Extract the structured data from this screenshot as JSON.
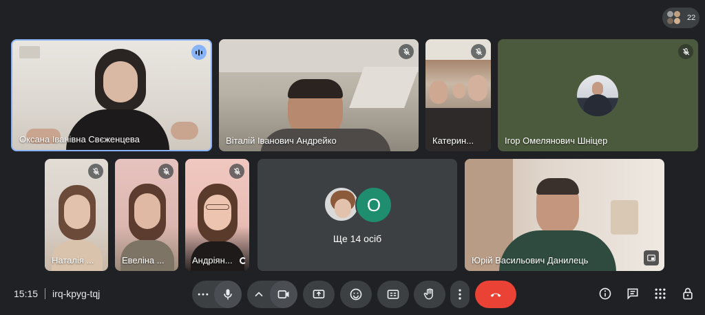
{
  "participants_badge": {
    "count": "22",
    "avatar_colors": [
      "#9e9e9e",
      "#c0a080",
      "#7a6a5a",
      "#d0b090"
    ]
  },
  "tiles": {
    "t1": {
      "name": "Оксана Іванівна Свєженцева"
    },
    "t2": {
      "name": "Віталій Іванович Андрейко"
    },
    "t3": {
      "name": "Катерин..."
    },
    "t4": {
      "name": "Ігор Омелянович Шніцер"
    },
    "t5": {
      "name": "Наталія ..."
    },
    "t6": {
      "name": "Евеліна ..."
    },
    "t7": {
      "name": "Андріян..."
    },
    "t8": {
      "name": "Юрій Васильович Данилець"
    }
  },
  "overflow_tile": {
    "label": "Ще 14 осіб",
    "avatar_letter": "O",
    "avatar_color": "#1e8e6e"
  },
  "bottom_bar": {
    "time": "15:15",
    "meeting_code": "irq-kpyg-tqj"
  },
  "colors": {
    "background": "#202124",
    "control": "#3c4043",
    "end_call": "#ea4335",
    "speaking_border": "#8ab4f8"
  }
}
